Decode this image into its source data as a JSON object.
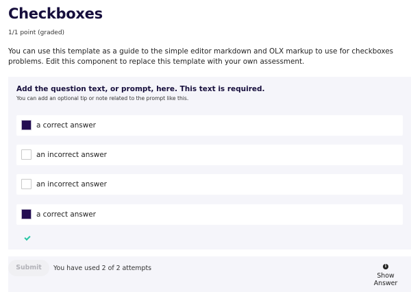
{
  "header": {
    "title": "Checkboxes",
    "points": "1/1 point (graded)",
    "description": "You can use this template as a guide to the simple editor markdown and OLX markup to use for checkboxes problems. Edit this component to replace this template with your own assessment."
  },
  "problem": {
    "prompt": "Add the question text, or prompt, here. This text is required.",
    "tip": "You can add an optional tip or note related to the prompt like this.",
    "choices": [
      {
        "label": "a correct answer",
        "checked": true
      },
      {
        "label": "an incorrect answer",
        "checked": false
      },
      {
        "label": "an incorrect answer",
        "checked": false
      },
      {
        "label": "a correct answer",
        "checked": true
      }
    ],
    "status": "correct"
  },
  "footer": {
    "submit_label": "Submit",
    "attempts_text": "You have used 2 of 2 attempts",
    "show_answer_label": "Show Answer",
    "info_icon_glyph": "i"
  },
  "colors": {
    "title": "#160e3c",
    "checked_box": "#230c52",
    "correct_mark": "#26c6a4",
    "panel_bg": "#f5f5fa"
  }
}
